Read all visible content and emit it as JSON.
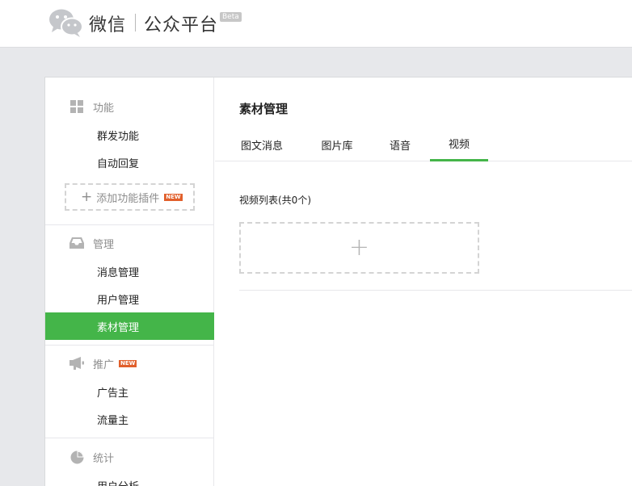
{
  "header": {
    "brand": "微信",
    "platform": "公众平台",
    "badge": "Beta"
  },
  "sidebar": {
    "groups": [
      {
        "label": "功能",
        "icon": "grid-icon",
        "items": [
          "群发功能",
          "自动回复"
        ]
      },
      {
        "label": "管理",
        "icon": "inbox-icon",
        "items": [
          "消息管理",
          "用户管理",
          "素材管理"
        ]
      },
      {
        "label": "推广",
        "icon": "megaphone-icon",
        "badge": "NEW",
        "items": [
          "广告主",
          "流量主"
        ]
      },
      {
        "label": "统计",
        "icon": "pie-chart-icon",
        "items": [
          "用户分析"
        ]
      }
    ],
    "add_plugin": {
      "label": "添加功能插件",
      "badge": "NEW"
    },
    "active_item": "素材管理"
  },
  "main": {
    "title": "素材管理",
    "tabs": [
      {
        "label": "图文消息"
      },
      {
        "label": "图片库"
      },
      {
        "label": "语音"
      },
      {
        "label": "视频"
      }
    ],
    "active_tab": "视频",
    "list_title": "视频列表(共0个)",
    "add_symbol": "+"
  },
  "colors": {
    "accent": "#44b549",
    "badge": "#e15f2b",
    "background": "#e7e8eb"
  }
}
